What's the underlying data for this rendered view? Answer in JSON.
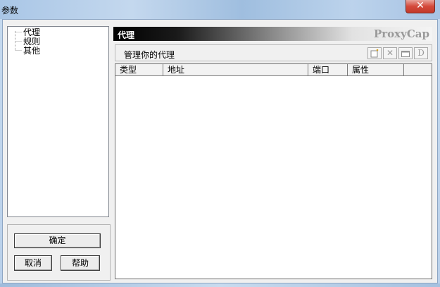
{
  "window": {
    "title": "参数",
    "close_label": "✕"
  },
  "tree": {
    "items": [
      {
        "label": "代理"
      },
      {
        "label": "规则"
      },
      {
        "label": "其他"
      }
    ]
  },
  "buttons": {
    "ok_label": "确定",
    "cancel_label": "取消",
    "help_label": "帮助"
  },
  "header": {
    "title": "代理",
    "brand": "ProxyCap"
  },
  "subheader": {
    "text": "管理你的代理",
    "toolbar": [
      {
        "icon": "new-icon",
        "glyph": "✱"
      },
      {
        "icon": "delete-icon",
        "glyph": "✕"
      },
      {
        "icon": "properties-icon",
        "glyph": "▤"
      },
      {
        "icon": "default-icon",
        "glyph": "D"
      }
    ]
  },
  "list": {
    "columns": [
      "类型",
      "地址",
      "端口",
      "属性"
    ],
    "rows": []
  },
  "colors": {
    "client_bg": "#f0f0f0",
    "titlebar": "#b9d0ea",
    "close_button": "#c23a2b",
    "brand_text": "#9a9a9a"
  }
}
